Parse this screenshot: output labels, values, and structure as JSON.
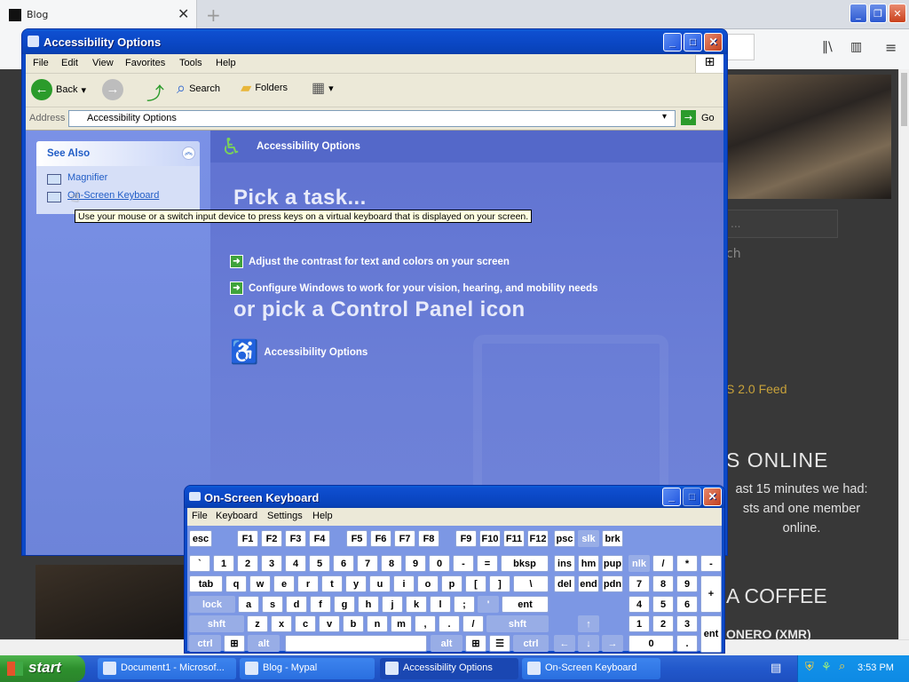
{
  "browser": {
    "tab_title": "Blog",
    "tab_close": "✕",
    "new_tab": "+",
    "page": {
      "search_placeholder": "...",
      "search_button": "ch",
      "feed": "S 2.0 Feed",
      "online_heading": "S ONLINE",
      "online_text": "ast 15 minutes we had: sts and one member online.",
      "coffee_heading": "A COFFEE",
      "xmr": "ONERO (XMR)"
    }
  },
  "accessibility_window": {
    "title": "Accessibility Options",
    "menu": [
      "File",
      "Edit",
      "View",
      "Favorites",
      "Tools",
      "Help"
    ],
    "toolbar": {
      "back": "Back",
      "search": "Search",
      "folders": "Folders"
    },
    "address_label": "Address",
    "address_value": "Accessibility Options",
    "go": "Go",
    "see_also": {
      "heading": "See Also",
      "links": [
        "Magnifier",
        "On-Screen Keyboard"
      ]
    },
    "tooltip": "Use your mouse or a switch input device to press keys on a virtual keyboard that is displayed on your screen.",
    "crumb": "Accessibility Options",
    "pick_task": "Pick a task...",
    "tasks": [
      "Adjust the contrast for text and colors on your screen",
      "Configure Windows to work for your vision, hearing, and mobility needs"
    ],
    "pick_icon": "or pick a Control Panel icon",
    "cp_icon_label": "Accessibility Options"
  },
  "osk": {
    "title": "On-Screen Keyboard",
    "menu": [
      "File",
      "Keyboard",
      "Settings",
      "Help"
    ],
    "rows": [
      [
        "esc",
        "F1",
        "F2",
        "F3",
        "F4",
        "F5",
        "F6",
        "F7",
        "F8",
        "F9",
        "F10",
        "F11",
        "F12",
        "psc",
        "slk",
        "brk"
      ],
      [
        "`",
        "1",
        "2",
        "3",
        "4",
        "5",
        "6",
        "7",
        "8",
        "9",
        "0",
        "-",
        "=",
        "bksp",
        "ins",
        "hm",
        "pup",
        "nlk",
        "/",
        "*",
        "-"
      ],
      [
        "tab",
        "q",
        "w",
        "e",
        "r",
        "t",
        "y",
        "u",
        "i",
        "o",
        "p",
        "[",
        "]",
        "\\",
        "del",
        "end",
        "pdn",
        "7",
        "8",
        "9",
        "+"
      ],
      [
        "lock",
        "a",
        "s",
        "d",
        "f",
        "g",
        "h",
        "j",
        "k",
        "l",
        ";",
        "'",
        "ent",
        "4",
        "5",
        "6"
      ],
      [
        "shft",
        "z",
        "x",
        "c",
        "v",
        "b",
        "n",
        "m",
        ",",
        ".",
        "/",
        "shft",
        "↑",
        "1",
        "2",
        "3",
        "ent"
      ],
      [
        "ctrl",
        "alt",
        "alt",
        "ctrl",
        "←",
        "↓",
        "→",
        "0",
        "."
      ]
    ]
  },
  "taskbar": {
    "start": "start",
    "items": [
      "Document1 - Microsof...",
      "Blog - Mypal",
      "Accessibility Options",
      "On-Screen Keyboard"
    ],
    "clock": "3:53 PM"
  }
}
